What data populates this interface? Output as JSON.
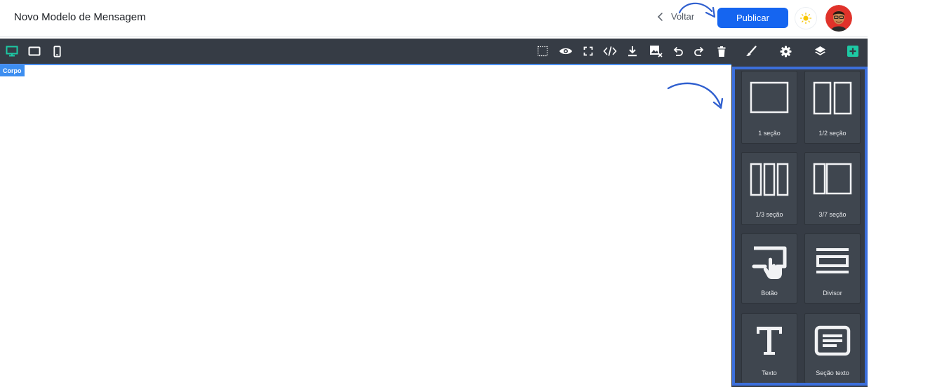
{
  "header": {
    "title": "Novo Modelo de Mensagem",
    "back_label": "Voltar",
    "publish_label": "Publicar"
  },
  "toolbar": {
    "devices": [
      "desktop-icon",
      "tablet-icon",
      "mobile-icon"
    ],
    "actions": [
      "outline-icon",
      "preview-icon",
      "fullscreen-icon",
      "code-icon",
      "download-icon",
      "clear-canvas-icon",
      "undo-icon",
      "redo-icon",
      "trash-icon"
    ],
    "panels": [
      "style-manager-icon",
      "settings-icon",
      "layers-icon",
      "blocks-icon"
    ]
  },
  "canvas": {
    "selected_label": "Corpo"
  },
  "blocks": [
    {
      "label": "1 seção",
      "icon": "one-section-icon"
    },
    {
      "label": "1/2 seção",
      "icon": "half-section-icon"
    },
    {
      "label": "1/3 seção",
      "icon": "third-section-icon"
    },
    {
      "label": "3/7 seção",
      "icon": "three-seven-section-icon"
    },
    {
      "label": "Botão",
      "icon": "button-icon"
    },
    {
      "label": "Divisor",
      "icon": "divider-icon"
    },
    {
      "label": "Texto",
      "icon": "text-icon"
    },
    {
      "label": "Seção texto",
      "icon": "text-section-icon"
    }
  ],
  "colors": {
    "accent": "#1565f0",
    "toolbar_bg": "#363c45",
    "active_icon": "#1dc9a4",
    "highlight_frame": "#3c6fdb"
  }
}
